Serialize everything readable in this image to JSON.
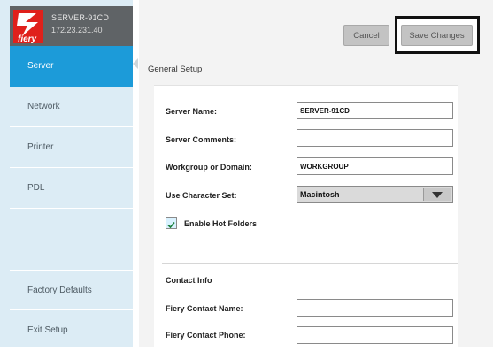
{
  "header": {
    "logo_text": "fiery",
    "server_name": "SERVER-91CD",
    "server_ip": "172.23.231.40"
  },
  "sidebar": {
    "items": [
      {
        "label": "Server",
        "active": true
      },
      {
        "label": "Network",
        "active": false
      },
      {
        "label": "Printer",
        "active": false
      },
      {
        "label": "PDL",
        "active": false
      }
    ],
    "bottom_items": [
      {
        "label": "Factory Defaults"
      },
      {
        "label": "Exit Setup"
      }
    ]
  },
  "toolbar": {
    "cancel_label": "Cancel",
    "save_label": "Save Changes"
  },
  "main": {
    "section_title": "General Setup",
    "server_name_label": "Server Name:",
    "server_name_value": "SERVER-91CD",
    "server_comments_label": "Server Comments:",
    "server_comments_value": "",
    "workgroup_label": "Workgroup or Domain:",
    "workgroup_value": "WORKGROUP",
    "charset_label": "Use Character Set:",
    "charset_value": "Macintosh",
    "hot_folders_label": "Enable Hot Folders",
    "hot_folders_checked": true,
    "contact_title": "Contact Info",
    "contact_name_label": "Fiery Contact Name:",
    "contact_name_value": "",
    "contact_phone_label": "Fiery Contact Phone:",
    "contact_phone_value": ""
  },
  "colors": {
    "sidebar_bg": "#dcecf5",
    "active_item": "#1c9bd9",
    "logo_bg": "#5f6366",
    "logo_red": "#e0201b"
  }
}
